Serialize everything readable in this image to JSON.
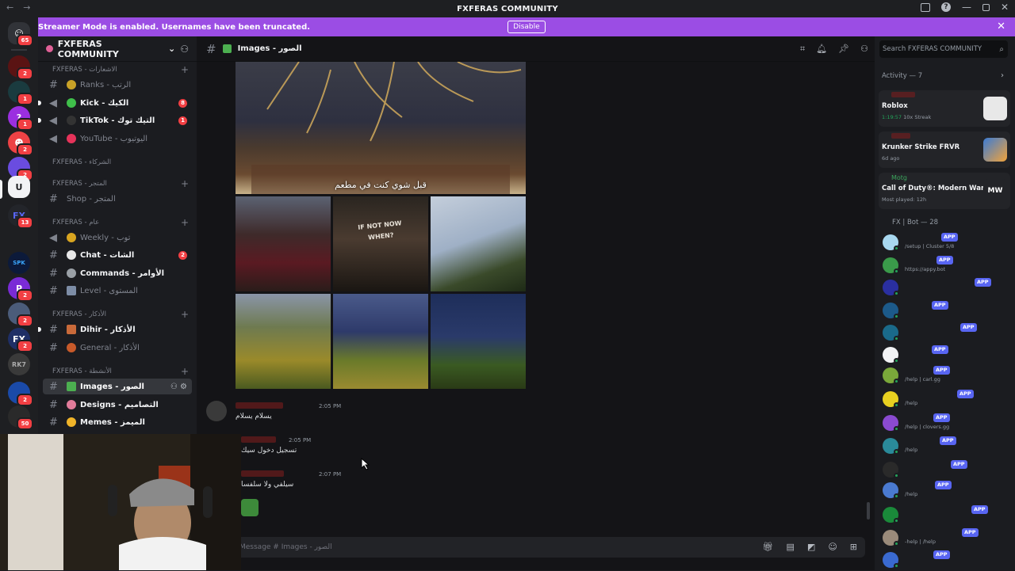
{
  "window": {
    "title": "FXFERAS COMMUNITY"
  },
  "banner": {
    "message": "Streamer Mode is enabled. Usernames have been truncated.",
    "button": "Disable"
  },
  "guild_badges": [
    "65",
    "2",
    "1",
    "1",
    "2",
    "2",
    "13",
    "2",
    "2",
    "2",
    "2",
    "2",
    "50"
  ],
  "server": {
    "name": "FXFERAS COMMUNITY"
  },
  "sidebar": {
    "categories": [
      {
        "label": "FXFERAS - الاشعارات"
      },
      {
        "label": "FXFERAS - الشركاء"
      },
      {
        "label": "FXFERAS - المتجر"
      },
      {
        "label": "FXFERAS - عام"
      },
      {
        "label": "FXFERAS - الأذكار"
      },
      {
        "label": "FXFERAS - الأنشطة"
      }
    ],
    "channels": [
      {
        "label": "Ranks - الرتب",
        "badge": ""
      },
      {
        "label": "Kick - الكيك",
        "badge": "8"
      },
      {
        "label": "TikTok - التيك توك",
        "badge": "1"
      },
      {
        "label": "YouTube - اليوتيوب",
        "badge": ""
      },
      {
        "label": "Shop - المتجر",
        "badge": ""
      },
      {
        "label": "Weekly - توب",
        "badge": ""
      },
      {
        "label": "Chat - الشات",
        "badge": "2"
      },
      {
        "label": "Commands - الأوامر",
        "badge": ""
      },
      {
        "label": "Level - المستوى",
        "badge": ""
      },
      {
        "label": "Dihir - الأذكار",
        "badge": ""
      },
      {
        "label": "General - الأذكار",
        "badge": ""
      },
      {
        "label": "Images - الصور",
        "badge": ""
      },
      {
        "label": "Designs - التصاميم",
        "badge": ""
      },
      {
        "label": "Memes - الميمز",
        "badge": ""
      }
    ]
  },
  "channel": {
    "title": "Images - الصور",
    "photo_caption": "قبل شوي كنت في مطعم",
    "composer_placeholder": "Message # Images - الصور"
  },
  "messages": [
    {
      "time": "2:05 PM",
      "text": "يسلام يسلام"
    },
    {
      "time": "2:05 PM",
      "text": "تسجيل دخول سيك"
    },
    {
      "time": "2:07 PM",
      "text": "سيلفي ولا سلفسا"
    }
  ],
  "members": {
    "search_placeholder": "Search FXFERAS COMMUNITY",
    "activity_header": "Activity — 7",
    "activities": [
      {
        "game": "Roblox",
        "meta_time": "1:19:57",
        "meta": "10x Streak"
      },
      {
        "game": "Krunker Strike FRVR",
        "meta": "6d ago"
      },
      {
        "user": "Motg",
        "game": "Call of Duty®: Modern Warf...",
        "meta": "Most played: 12h"
      }
    ],
    "bot_header": "FX | Bot — 28",
    "app_label": "APP",
    "bot_subs": [
      "/setup | Cluster 5/8",
      "https://appy.bot",
      "",
      "",
      "",
      "",
      "/help | carl.gg",
      "/help",
      "/help | clovers.gg",
      "/help",
      "",
      "/help",
      "",
      "-help | /help",
      ""
    ]
  },
  "colors": {
    "accent": "#9b4de4",
    "mention": "#f23f43",
    "online": "#23a55a",
    "app": "#5865f2"
  }
}
